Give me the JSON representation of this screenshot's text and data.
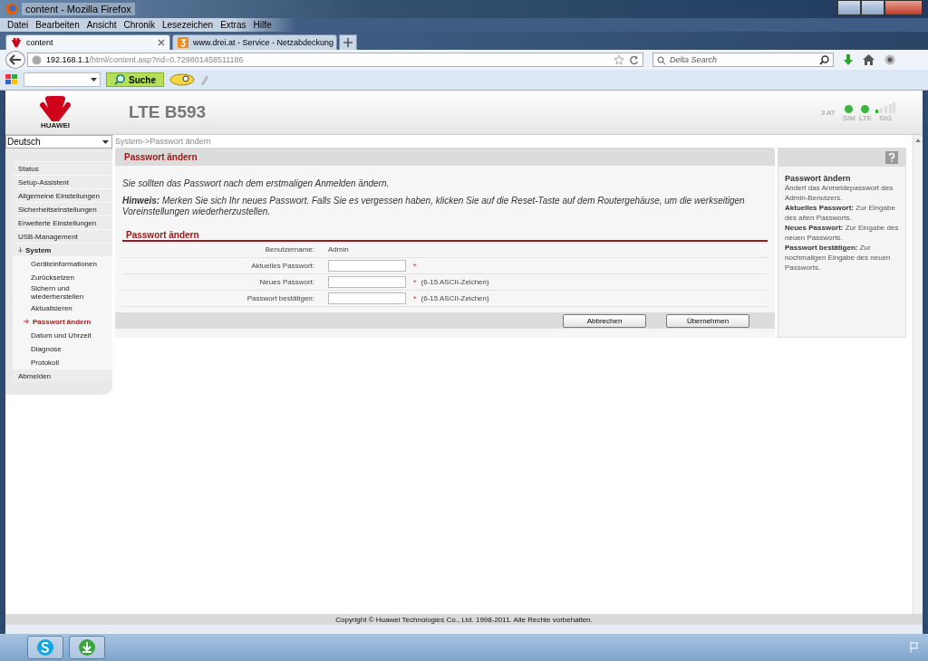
{
  "window": {
    "title": "content - Mozilla Firefox"
  },
  "menu": [
    "Datei",
    "Bearbeiten",
    "Ansicht",
    "Chronik",
    "Lesezeichen",
    "Extras",
    "Hilfe"
  ],
  "tabs": [
    {
      "label": "content",
      "selected": true,
      "kind": "huawei"
    },
    {
      "label": "www.drei.at - Service - Netzabdeckung",
      "selected": false,
      "kind": "drei"
    }
  ],
  "address": {
    "host": "192.168.1.1",
    "path": "/html/content.asp?rid=0.729801458511186"
  },
  "search": {
    "placeholder": "Delta Search"
  },
  "toolbar": {
    "search_button": "Suche"
  },
  "page": {
    "brand": "HUAWEI",
    "product": "LTE B593",
    "operator": "3 AT",
    "indicators": [
      {
        "label": "SIM",
        "on": true
      },
      {
        "label": "LTE",
        "on": true
      }
    ],
    "signal_label": "SIG",
    "language": "Deutsch",
    "breadcrumb": "System->Passwort ändern",
    "nav": [
      {
        "label": "Status",
        "selected": false
      },
      {
        "label": "Setup-Assistent",
        "selected": false
      },
      {
        "label": "Allgemeine Einstellungen",
        "selected": false
      },
      {
        "label": "Sicherheitseinstellungen",
        "selected": false
      },
      {
        "label": "Erweiterte Einstellungen",
        "selected": false
      },
      {
        "label": "USB-Management",
        "selected": false
      },
      {
        "label": "System",
        "selected": false,
        "expanded": true,
        "children": [
          {
            "label": "Geräteinformationen",
            "selected": false
          },
          {
            "label": "Zurücksetzen",
            "selected": false
          },
          {
            "label": "Sichern und wiederherstellen",
            "selected": false
          },
          {
            "label": "Aktualisieren",
            "selected": false
          },
          {
            "label": "Passwort ändern",
            "selected": true
          },
          {
            "label": "Datum und Uhrzeit",
            "selected": false
          },
          {
            "label": "Diagnose",
            "selected": false
          },
          {
            "label": "Protokoll",
            "selected": false
          }
        ]
      },
      {
        "label": "Abmelden",
        "selected": false
      }
    ],
    "panel_title": "Passwort ändern",
    "intro": "Sie sollten das Passwort nach dem erstmaligen Anmelden ändern.",
    "hint": "**Hinweis:** Merken Sie sich Ihr neues Passwort. Falls Sie es vergessen haben, klicken Sie auf die Reset-Taste auf dem Routergehäuse, um die werkseitigen Voreinstellungen wiederherzustellen.",
    "section_title": "Passwort ändern",
    "fields": [
      {
        "label": "Benutzername:",
        "kind": "text",
        "value": "Admin"
      },
      {
        "label": "Aktuelles Passwort:",
        "kind": "password",
        "mark": "*"
      },
      {
        "label": "Neues Passwort:",
        "kind": "password",
        "mark": "*",
        "note": "(6-15 ASCII-Zeichen)"
      },
      {
        "label": "Passwort bestätigen:",
        "kind": "password",
        "mark": "*",
        "note": "(6-15 ASCII-Zeichen)"
      }
    ],
    "buttons": [
      "Abbrechen",
      "Übernehmen"
    ],
    "help_title": "Passwort ändern",
    "help": [
      "Ändert das Anmeldepasswort des Admin-Benutzers.",
      "**Aktuelles Passwort:** Zur Eingabe des alten Passworts.",
      "**Neues Passwort:** Zur Eingabe des neuen Passworts.",
      "**Passwort bestätigen:** Zur nochmaligen Eingabe des neuen Passworts."
    ],
    "copyright": "Copyright © Huawei Technologies Co., Ltd. 1998-2011. Alle Rechte vorbehalten."
  }
}
